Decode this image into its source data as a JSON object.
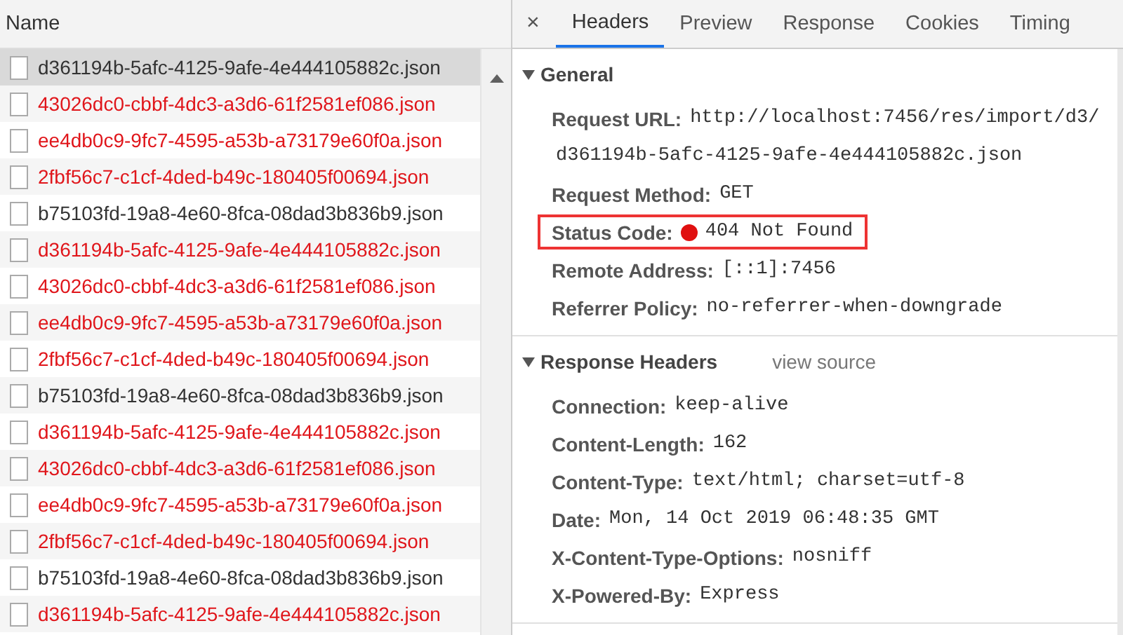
{
  "request_list": {
    "column": "Name",
    "rows": [
      {
        "name": "d361194b-5afc-4125-9afe-4e444105882c.json",
        "failed": false,
        "selected": true
      },
      {
        "name": "43026dc0-cbbf-4dc3-a3d6-61f2581ef086.json",
        "failed": true,
        "selected": false
      },
      {
        "name": "ee4db0c9-9fc7-4595-a53b-a73179e60f0a.json",
        "failed": true,
        "selected": false
      },
      {
        "name": "2fbf56c7-c1cf-4ded-b49c-180405f00694.json",
        "failed": true,
        "selected": false
      },
      {
        "name": "b75103fd-19a8-4e60-8fca-08dad3b836b9.json",
        "failed": false,
        "selected": false
      },
      {
        "name": "d361194b-5afc-4125-9afe-4e444105882c.json",
        "failed": true,
        "selected": false
      },
      {
        "name": "43026dc0-cbbf-4dc3-a3d6-61f2581ef086.json",
        "failed": true,
        "selected": false
      },
      {
        "name": "ee4db0c9-9fc7-4595-a53b-a73179e60f0a.json",
        "failed": true,
        "selected": false
      },
      {
        "name": "2fbf56c7-c1cf-4ded-b49c-180405f00694.json",
        "failed": true,
        "selected": false
      },
      {
        "name": "b75103fd-19a8-4e60-8fca-08dad3b836b9.json",
        "failed": false,
        "selected": false
      },
      {
        "name": "d361194b-5afc-4125-9afe-4e444105882c.json",
        "failed": true,
        "selected": false
      },
      {
        "name": "43026dc0-cbbf-4dc3-a3d6-61f2581ef086.json",
        "failed": true,
        "selected": false
      },
      {
        "name": "ee4db0c9-9fc7-4595-a53b-a73179e60f0a.json",
        "failed": true,
        "selected": false
      },
      {
        "name": "2fbf56c7-c1cf-4ded-b49c-180405f00694.json",
        "failed": true,
        "selected": false
      },
      {
        "name": "b75103fd-19a8-4e60-8fca-08dad3b836b9.json",
        "failed": false,
        "selected": false
      },
      {
        "name": "d361194b-5afc-4125-9afe-4e444105882c.json",
        "failed": true,
        "selected": false
      }
    ]
  },
  "details": {
    "close": "×",
    "tabs": [
      {
        "label": "Headers",
        "selected": true
      },
      {
        "label": "Preview",
        "selected": false
      },
      {
        "label": "Response",
        "selected": false
      },
      {
        "label": "Cookies",
        "selected": false
      },
      {
        "label": "Timing",
        "selected": false
      }
    ],
    "sections": [
      {
        "title": "General",
        "expanded": true,
        "fields": [
          {
            "key": "Request URL:",
            "value_lines": [
              "http://localhost:7456/res/import/d3/",
              "d361194b-5afc-4125-9afe-4e444105882c.json"
            ],
            "highlighted": false
          },
          {
            "key": "Request Method:",
            "value_lines": [
              "GET"
            ],
            "highlighted": false
          },
          {
            "key": "Status Code:",
            "value_lines": [
              "404 Not Found"
            ],
            "color": "#e01010",
            "highlighted": true
          },
          {
            "key": "Remote Address:",
            "value_lines": [
              "[::1]:7456"
            ],
            "highlighted": false
          },
          {
            "key": "Referrer Policy:",
            "value_lines": [
              "no-referrer-when-downgrade"
            ],
            "highlighted": false
          }
        ]
      },
      {
        "title": "Response Headers",
        "link": "view source",
        "expanded": true,
        "fields": [
          {
            "key": "Connection:",
            "value_lines": [
              "keep-alive"
            ],
            "highlighted": false
          },
          {
            "key": "Content-Length:",
            "value_lines": [
              "162"
            ],
            "highlighted": false
          },
          {
            "key": "Content-Type:",
            "value_lines": [
              "text/html; charset=utf-8"
            ],
            "highlighted": false
          },
          {
            "key": "Date:",
            "value_lines": [
              "Mon, 14 Oct 2019 06:48:35 GMT"
            ],
            "highlighted": false
          },
          {
            "key": "X-Content-Type-Options:",
            "value_lines": [
              "nosniff"
            ],
            "highlighted": false
          },
          {
            "key": "X-Powered-By:",
            "value_lines": [
              "Express"
            ],
            "highlighted": false
          }
        ]
      }
    ]
  }
}
